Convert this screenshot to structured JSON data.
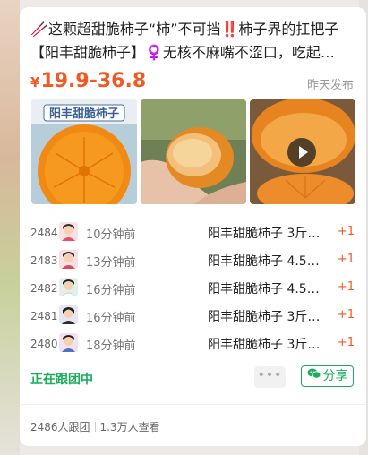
{
  "post": {
    "title_line1": "🥢这颗超甜脆柿子“柿”不可挡‼️柿子界的扛把子",
    "title_line2": "【阳丰甜脆柿子】♀️无核不麻嘴不涩口，吃起…",
    "price_currency": "¥",
    "price_range": "19.9-36.8",
    "posted_time": "昨天发布",
    "photo1_banner": "阳丰甜脆柿子",
    "photo3_icon": "play-icon"
  },
  "group_buys": [
    {
      "num": "2484",
      "time": "10分钟前",
      "product": "阳丰甜脆柿子 3斤…",
      "count": "+1"
    },
    {
      "num": "2483",
      "time": "13分钟前",
      "product": "阳丰甜脆柿子 4.5…",
      "count": "+1"
    },
    {
      "num": "2482",
      "time": "16分钟前",
      "product": "阳丰甜脆柿子 4.5…",
      "count": "+1"
    },
    {
      "num": "2481",
      "time": "16分钟前",
      "product": "阳丰甜脆柿子 3斤…",
      "count": "+1"
    },
    {
      "num": "2480",
      "time": "18分钟前",
      "product": "阳丰甜脆柿子 3斤…",
      "count": "+1"
    }
  ],
  "actions": {
    "following_label": "正在跟团中",
    "more_label": "•••",
    "share_label": "分享"
  },
  "stats": {
    "participants": "2486人跟团",
    "views": "1.3万人查看"
  },
  "colors": {
    "accent": "#f15a24",
    "brand_green": "#1aad5d"
  }
}
